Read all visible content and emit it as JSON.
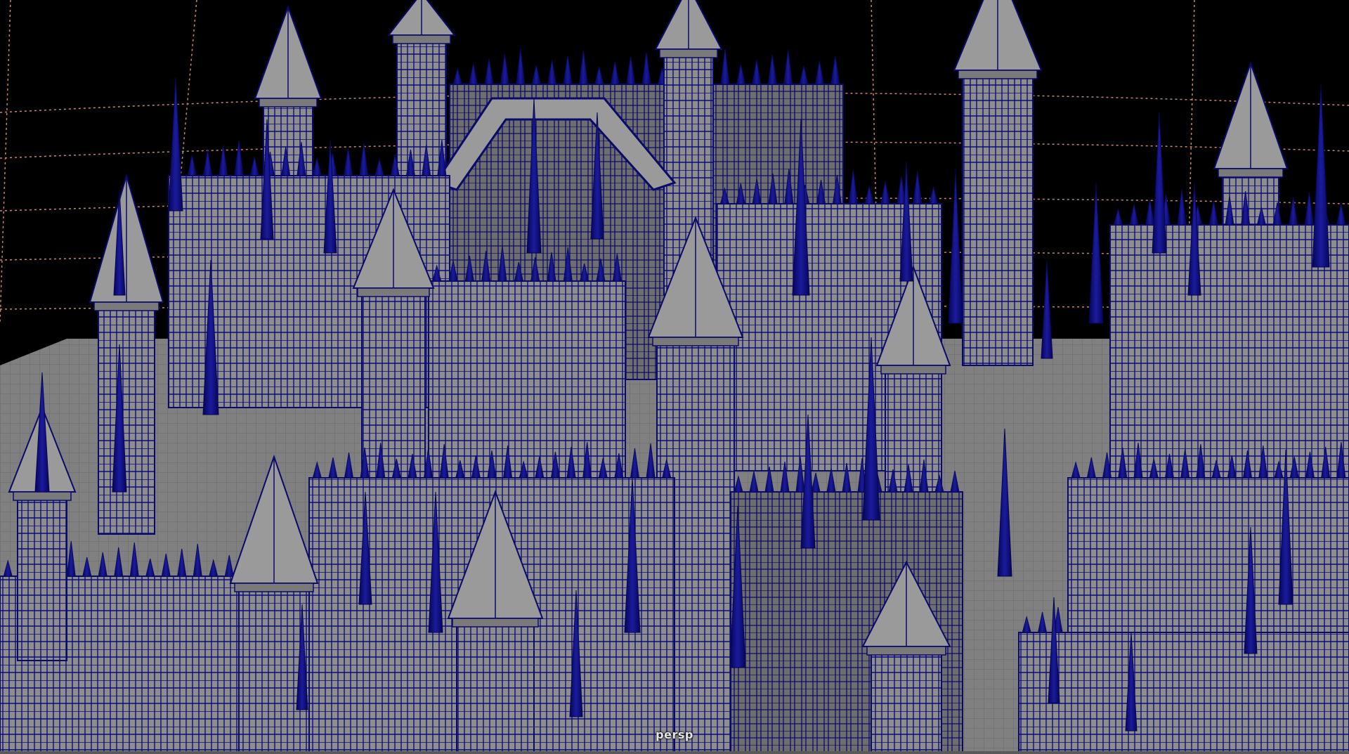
{
  "viewport": {
    "camera_label": "persp"
  },
  "colors": {
    "background": "#000000",
    "surface": "#8f8f8f",
    "surface_shadow": "#5f5f5f",
    "wireframe": "#0a0a7a",
    "grid_lines": "#c8876e",
    "ground": "#7a7a7a"
  }
}
